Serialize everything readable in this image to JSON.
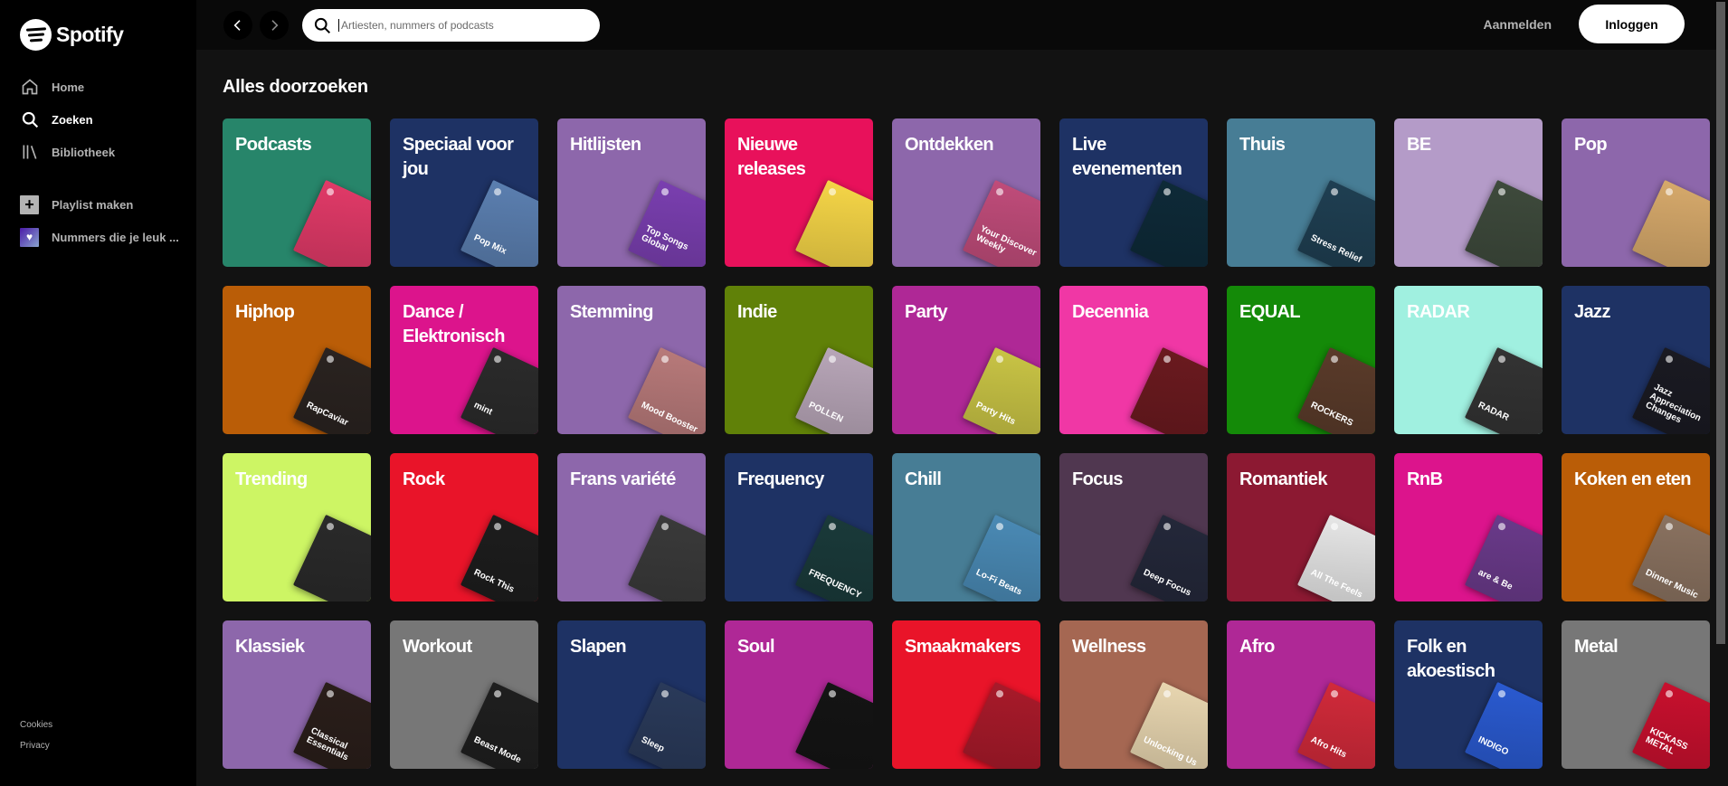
{
  "brand": {
    "name": "Spotify"
  },
  "sidebar": {
    "nav": [
      {
        "label": "Home",
        "icon": "home-icon"
      },
      {
        "label": "Zoeken",
        "icon": "search-icon"
      },
      {
        "label": "Bibliotheek",
        "icon": "library-icon"
      }
    ],
    "create_playlist": "Playlist maken",
    "liked_songs": "Nummers die je leuk ...",
    "footer": {
      "cookies": "Cookies",
      "privacy": "Privacy"
    }
  },
  "topbar": {
    "search_placeholder": "Artiesten, nummers of podcasts",
    "signup": "Aanmelden",
    "login": "Inloggen"
  },
  "page_title": "Alles doorzoeken",
  "categories": [
    {
      "label": "Podcasts",
      "bg": "#27856a",
      "cover_bg": "#e13a68",
      "cover_label": ""
    },
    {
      "label": "Speciaal voor jou",
      "bg": "#1e3264",
      "cover_bg": "#5b7fb0",
      "cover_label": "Pop Mix"
    },
    {
      "label": "Hitlijsten",
      "bg": "#8d67ab",
      "cover_bg": "#7a3fb0",
      "cover_label": "Top Songs Global"
    },
    {
      "label": "Nieuwe releases",
      "bg": "#e8115b",
      "cover_bg": "#f5d547",
      "cover_label": ""
    },
    {
      "label": "Ontdekken",
      "bg": "#8d67ab",
      "cover_bg": "#c04c7a",
      "cover_label": "Your Discover Weekly"
    },
    {
      "label": "Live evenementen",
      "bg": "#1e3264",
      "cover_bg": "#0e2a38",
      "cover_label": ""
    },
    {
      "label": "Thuis",
      "bg": "#477d95",
      "cover_bg": "#1f3f52",
      "cover_label": "Stress Relief"
    },
    {
      "label": "BE",
      "bg": "#b49bc8",
      "cover_bg": "#3e4a3c",
      "cover_label": ""
    },
    {
      "label": "Pop",
      "bg": "#8d67ab",
      "cover_bg": "#d6a96b",
      "cover_label": ""
    },
    {
      "label": "Hiphop",
      "bg": "#ba5d07",
      "cover_bg": "#2a2320",
      "cover_label": "RapCaviar"
    },
    {
      "label": "Dance / Elektronisch",
      "bg": "#dc148c",
      "cover_bg": "#2b2b2b",
      "cover_label": "mint"
    },
    {
      "label": "Stemming",
      "bg": "#8d67ab",
      "cover_bg": "#b87a7a",
      "cover_label": "Mood Booster"
    },
    {
      "label": "Indie",
      "bg": "#608108",
      "cover_bg": "#b8a6b8",
      "cover_label": "POLLEN"
    },
    {
      "label": "Party",
      "bg": "#af2896",
      "cover_bg": "#c9c445",
      "cover_label": "Party Hits"
    },
    {
      "label": "Decennia",
      "bg": "#f037a5",
      "cover_bg": "#6b1a1f",
      "cover_label": ""
    },
    {
      "label": "EQUAL",
      "bg": "#148a08",
      "cover_bg": "#5a3b2a",
      "cover_label": "ROCKERS"
    },
    {
      "label": "RADAR",
      "bg": "#a0f0e0",
      "cover_bg": "#333333",
      "cover_label": "RADAR"
    },
    {
      "label": "Jazz",
      "bg": "#1e3264",
      "cover_bg": "#1a1a22",
      "cover_label": "Jazz Appreciation Changes"
    },
    {
      "label": "Trending",
      "bg": "#cdf564",
      "cover_bg": "#2a2a2a",
      "cover_label": ""
    },
    {
      "label": "Rock",
      "bg": "#e91429",
      "cover_bg": "#1d1d1d",
      "cover_label": "Rock This"
    },
    {
      "label": "Frans variété",
      "bg": "#8d67ab",
      "cover_bg": "#3a3a3a",
      "cover_label": ""
    },
    {
      "label": "Frequency",
      "bg": "#1e3264",
      "cover_bg": "#1a3a3a",
      "cover_label": "FREQUENCY"
    },
    {
      "label": "Chill",
      "bg": "#477d95",
      "cover_bg": "#4a8ab5",
      "cover_label": "Lo-Fi Beats"
    },
    {
      "label": "Focus",
      "bg": "#503750",
      "cover_bg": "#24283a",
      "cover_label": "Deep Focus"
    },
    {
      "label": "Romantiek",
      "bg": "#8c1932",
      "cover_bg": "#e6e6e6",
      "cover_label": "All The Feels"
    },
    {
      "label": "RnB",
      "bg": "#dc148c",
      "cover_bg": "#6a3a8a",
      "cover_label": "are & Be"
    },
    {
      "label": "Koken en eten",
      "bg": "#ba5d07",
      "cover_bg": "#8a7260",
      "cover_label": "Dinner Music"
    },
    {
      "label": "Klassiek",
      "bg": "#8d67ab",
      "cover_bg": "#2a1e1a",
      "cover_label": "Classical Essentials"
    },
    {
      "label": "Workout",
      "bg": "#777777",
      "cover_bg": "#1f1f1f",
      "cover_label": "Beast Mode"
    },
    {
      "label": "Slapen",
      "bg": "#1e3264",
      "cover_bg": "#2a3a5a",
      "cover_label": "Sleep"
    },
    {
      "label": "Soul",
      "bg": "#af2896",
      "cover_bg": "#141414",
      "cover_label": ""
    },
    {
      "label": "Smaakmakers",
      "bg": "#e91429",
      "cover_bg": "#a81a2a",
      "cover_label": ""
    },
    {
      "label": "Wellness",
      "bg": "#a56752",
      "cover_bg": "#e8d6b0",
      "cover_label": "Unlocking Us"
    },
    {
      "label": "Afro",
      "bg": "#af2896",
      "cover_bg": "#d12a3a",
      "cover_label": "Afro Hits"
    },
    {
      "label": "Folk en akoestisch",
      "bg": "#1e3264",
      "cover_bg": "#2a5ad0",
      "cover_label": "INDIGO"
    },
    {
      "label": "Metal",
      "bg": "#777777",
      "cover_bg": "#c8102e",
      "cover_label": "KICKASS METAL"
    }
  ]
}
